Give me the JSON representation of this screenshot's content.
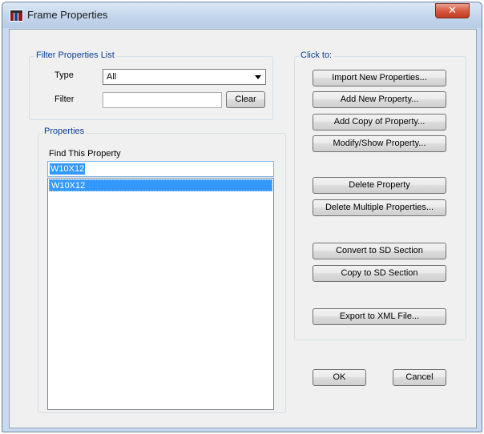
{
  "window": {
    "title": "Frame Properties",
    "close_glyph": "✕",
    "app_icon": "frame-properties-app-icon"
  },
  "filter": {
    "group_label": "Filter Properties List",
    "type_label": "Type",
    "type_value": "All",
    "filter_label": "Filter",
    "filter_value": "",
    "clear_label": "Clear"
  },
  "properties": {
    "group_label": "Properties",
    "find_label": "Find This Property",
    "find_value": "W10X12",
    "items": [
      "W10X12"
    ]
  },
  "actions": {
    "group_label": "Click to:",
    "import_label": "Import New Properties...",
    "add_new_label": "Add New Property...",
    "add_copy_label": "Add Copy of Property...",
    "modify_label": "Modify/Show Property...",
    "delete_label": "Delete Property",
    "delete_multiple_label": "Delete Multiple Properties...",
    "convert_sd_label": "Convert to SD Section",
    "copy_sd_label": "Copy to SD Section",
    "export_xml_label": "Export to XML File..."
  },
  "footer": {
    "ok_label": "OK",
    "cancel_label": "Cancel"
  },
  "colors": {
    "group_label_text": "#0a3c96",
    "selection": "#3399ff",
    "close_button": "#d65a40"
  }
}
